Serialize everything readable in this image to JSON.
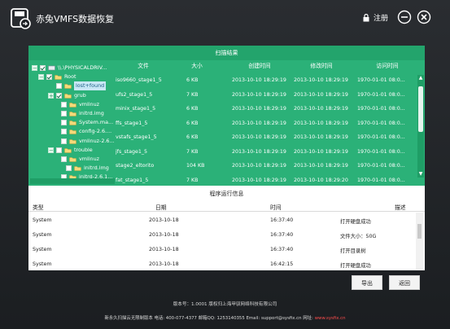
{
  "app": {
    "title": "赤兔VMFS数据恢复",
    "register_label": "注册"
  },
  "scan": {
    "title": "扫描结果",
    "columns": [
      "文件",
      "大小",
      "创建时间",
      "修改时间",
      "访问时间"
    ],
    "tree": [
      {
        "label": "\\\\.\\PHYSICALDRIV...",
        "checked": true,
        "expander": "-"
      },
      {
        "label": "Root",
        "checked": true,
        "expander": "-"
      },
      {
        "label": "lost+found",
        "checked": false,
        "expander": "",
        "selected": true
      },
      {
        "label": "grub",
        "checked": true,
        "expander": "+"
      },
      {
        "label": "vmlinuz",
        "checked": false,
        "expander": ""
      },
      {
        "label": "initrd.img",
        "checked": false,
        "expander": ""
      },
      {
        "label": "System.ma...",
        "checked": false,
        "expander": ""
      },
      {
        "label": "config-2.6....",
        "checked": false,
        "expander": ""
      },
      {
        "label": "vmlinuz-2.6....",
        "checked": false,
        "expander": ""
      },
      {
        "label": "trouble",
        "checked": false,
        "expander": "-"
      },
      {
        "label": "vmlinuz",
        "checked": false,
        "expander": ""
      },
      {
        "label": "initrd.img",
        "checked": false,
        "expander": ""
      },
      {
        "label": "initrd-2.6.1...",
        "checked": false,
        "expander": ""
      }
    ],
    "files": [
      {
        "name": "iso9660_stage1_5",
        "size": "6 KB",
        "created": "2013-10-10 18:29:19",
        "modified": "2013-10-10 18:29:19",
        "accessed": "1970-01-01 08:0..."
      },
      {
        "name": "ufs2_stage1_5",
        "size": "7 KB",
        "created": "2013-10-10 18:29:19",
        "modified": "2013-10-10 18:29:19",
        "accessed": "1970-01-01 08:0..."
      },
      {
        "name": "minix_stage1_5",
        "size": "6 KB",
        "created": "2013-10-10 18:29:19",
        "modified": "2013-10-10 18:29:19",
        "accessed": "1970-01-01 08:0..."
      },
      {
        "name": "ffs_stage1_5",
        "size": "6 KB",
        "created": "2013-10-10 18:29:19",
        "modified": "2013-10-10 18:29:19",
        "accessed": "1970-01-01 08:0..."
      },
      {
        "name": "vstafs_stage1_5",
        "size": "6 KB",
        "created": "2013-10-10 18:29:19",
        "modified": "2013-10-10 18:29:19",
        "accessed": "1970-01-01 08:0..."
      },
      {
        "name": "jfs_stage1_5",
        "size": "7 KB",
        "created": "2013-10-10 18:29:19",
        "modified": "2013-10-10 18:29:19",
        "accessed": "1970-01-01 08:0..."
      },
      {
        "name": "stage2_eltorito",
        "size": "104 KB",
        "created": "2013-10-10 18:29:19",
        "modified": "2013-10-10 18:29:19",
        "accessed": "1970-01-01 08:0..."
      },
      {
        "name": "fat_stage1_5",
        "size": "7 KB",
        "created": "2013-10-10 18:29:19",
        "modified": "2013-10-10 18:29:20",
        "accessed": "1970-01-01 08:0..."
      }
    ]
  },
  "log": {
    "title": "程序运行信息",
    "columns": [
      "类型",
      "日期",
      "时间",
      "描述"
    ],
    "rows": [
      {
        "type": "System",
        "date": "2013-10-18",
        "time": "16:37:40",
        "desc": "打开硬盘成功"
      },
      {
        "type": "System",
        "date": "2013-10-18",
        "time": "16:37:40",
        "desc": "文件大小：50G"
      },
      {
        "type": "System",
        "date": "2013-10-18",
        "time": "16:37:40",
        "desc": "打开目录树"
      },
      {
        "type": "System",
        "date": "2013-10-18",
        "time": "16:42:15",
        "desc": "打开硬盘成功"
      }
    ]
  },
  "buttons": {
    "export": "导出",
    "back": "返回"
  },
  "footer": {
    "version": "版本号：1.0001   版权归上海甲驭网络科技有限公司",
    "contact": "新永久扫描云无限制版本  电话: 400-077-4377 邮箱QQ: 1253140355 Email: support@sysfix.cn 网址:",
    "website": "www.sysfix.cn"
  },
  "colors": {
    "panel": "#2bb178",
    "background": "#1f2226",
    "link": "#ff4d4d"
  }
}
